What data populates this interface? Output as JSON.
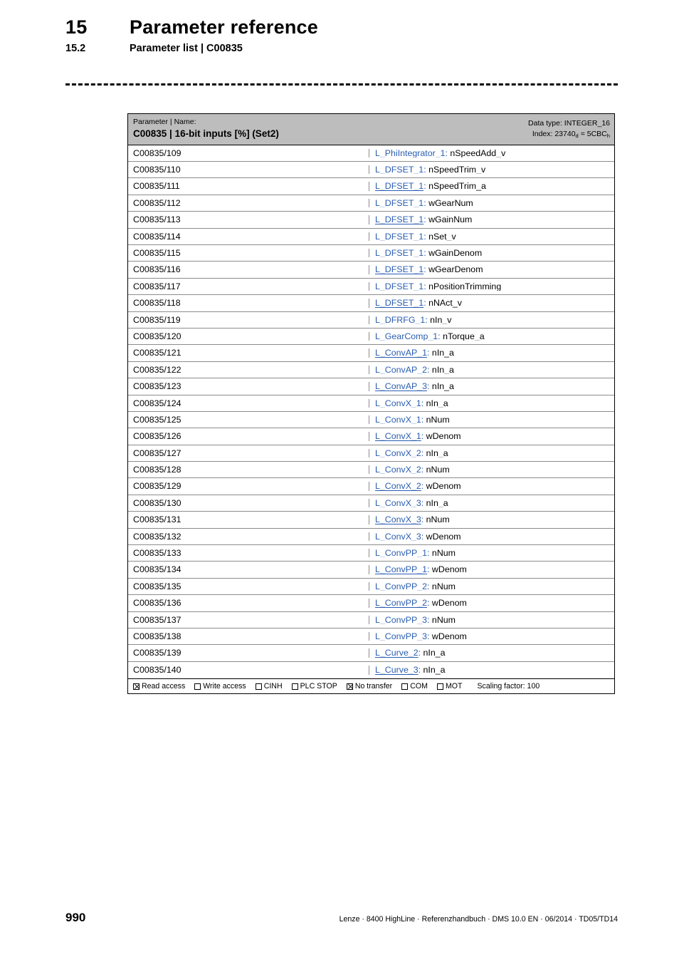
{
  "header": {
    "chapter_number": "15",
    "chapter_title": "Parameter reference",
    "section_number": "15.2",
    "section_title": "Parameter list | C00835"
  },
  "table": {
    "head": {
      "kicker": "Parameter | Name:",
      "title": "C00835 | 16-bit inputs [%] (Set2)",
      "data_type": "Data type: INTEGER_16",
      "index_label": "Index: ",
      "index_dec": "23740",
      "index_dec_sub": "d",
      "index_eq": " = ",
      "index_hex": "5CBC",
      "index_hex_sub": "h"
    },
    "rows": [
      {
        "code": "C00835/109",
        "block": "L_PhiIntegrator_1",
        "sep": ": ",
        "member": "nSpeedAdd_v"
      },
      {
        "code": "C00835/110",
        "block": "L_DFSET_1",
        "sep": ": ",
        "member": "nSpeedTrim_v"
      },
      {
        "code": "C00835/111",
        "block": "L_DFSET_1",
        "sep": ": ",
        "member": "nSpeedTrim_a"
      },
      {
        "code": "C00835/112",
        "block": "L_DFSET_1",
        "sep": ": ",
        "member": "wGearNum"
      },
      {
        "code": "C00835/113",
        "block": "L_DFSET_1",
        "sep": ": ",
        "member": "wGainNum"
      },
      {
        "code": "C00835/114",
        "block": "L_DFSET_1",
        "sep": ": ",
        "member": "nSet_v"
      },
      {
        "code": "C00835/115",
        "block": "L_DFSET_1",
        "sep": ": ",
        "member": "wGainDenom"
      },
      {
        "code": "C00835/116",
        "block": "L_DFSET_1",
        "sep": ": ",
        "member": "wGearDenom"
      },
      {
        "code": "C00835/117",
        "block": "L_DFSET_1",
        "sep": ": ",
        "member": "nPositionTrimming"
      },
      {
        "code": "C00835/118",
        "block": "L_DFSET_1",
        "sep": ": ",
        "member": "nNAct_v"
      },
      {
        "code": "C00835/119",
        "block": "L_DFRFG_1",
        "sep": ": ",
        "member": "nIn_v"
      },
      {
        "code": "C00835/120",
        "block": "L_GearComp_1",
        "sep": ": ",
        "member": "nTorque_a"
      },
      {
        "code": "C00835/121",
        "block": "L_ConvAP_1",
        "sep": ": ",
        "member": "nIn_a"
      },
      {
        "code": "C00835/122",
        "block": "L_ConvAP_2",
        "sep": ": ",
        "member": "nIn_a"
      },
      {
        "code": "C00835/123",
        "block": "L_ConvAP_3",
        "sep": ": ",
        "member": "nIn_a"
      },
      {
        "code": "C00835/124",
        "block": "L_ConvX_1",
        "sep": ": ",
        "member": "nIn_a"
      },
      {
        "code": "C00835/125",
        "block": "L_ConvX_1",
        "sep": ": ",
        "member": "nNum"
      },
      {
        "code": "C00835/126",
        "block": "L_ConvX_1",
        "sep": ": ",
        "member": "wDenom"
      },
      {
        "code": "C00835/127",
        "block": "L_ConvX_2",
        "sep": ": ",
        "member": "nIn_a"
      },
      {
        "code": "C00835/128",
        "block": "L_ConvX_2",
        "sep": ": ",
        "member": "nNum"
      },
      {
        "code": "C00835/129",
        "block": "L_ConvX_2",
        "sep": ": ",
        "member": "wDenom"
      },
      {
        "code": "C00835/130",
        "block": "L_ConvX_3",
        "sep": ": ",
        "member": "nIn_a"
      },
      {
        "code": "C00835/131",
        "block": "L_ConvX_3",
        "sep": ": ",
        "member": "nNum"
      },
      {
        "code": "C00835/132",
        "block": "L_ConvX_3",
        "sep": ": ",
        "member": "wDenom"
      },
      {
        "code": "C00835/133",
        "block": "L_ConvPP_1",
        "sep": ": ",
        "member": "nNum"
      },
      {
        "code": "C00835/134",
        "block": "L_ConvPP_1",
        "sep": ": ",
        "member": "wDenom"
      },
      {
        "code": "C00835/135",
        "block": "L_ConvPP_2",
        "sep": ": ",
        "member": "nNum"
      },
      {
        "code": "C00835/136",
        "block": "L_ConvPP_2",
        "sep": ": ",
        "member": "wDenom"
      },
      {
        "code": "C00835/137",
        "block": "L_ConvPP_3",
        "sep": ": ",
        "member": "nNum"
      },
      {
        "code": "C00835/138",
        "block": "L_ConvPP_3",
        "sep": ": ",
        "member": "wDenom"
      },
      {
        "code": "C00835/139",
        "block": "L_Curve_2",
        "sep": ": ",
        "member": "nIn_a"
      },
      {
        "code": "C00835/140",
        "block": "L_Curve_3",
        "sep": ": ",
        "member": "nIn_a"
      }
    ],
    "access": {
      "items": [
        {
          "label": "Read access",
          "checked": true
        },
        {
          "label": "Write access",
          "checked": false
        },
        {
          "label": "CINH",
          "checked": false
        },
        {
          "label": "PLC STOP",
          "checked": false
        },
        {
          "label": "No transfer",
          "checked": true
        },
        {
          "label": "COM",
          "checked": false
        },
        {
          "label": "MOT",
          "checked": false
        }
      ],
      "scaling": "Scaling factor: 100"
    }
  },
  "footer": {
    "page_number": "990",
    "imprint": "Lenze · 8400 HighLine · Referenzhandbuch · DMS 10.0 EN · 06/2014 · TD05/TD14"
  },
  "colors": {
    "link": "#2a5db0",
    "header_bg": "#bdbdbd",
    "rule": "#8c8c8c"
  }
}
